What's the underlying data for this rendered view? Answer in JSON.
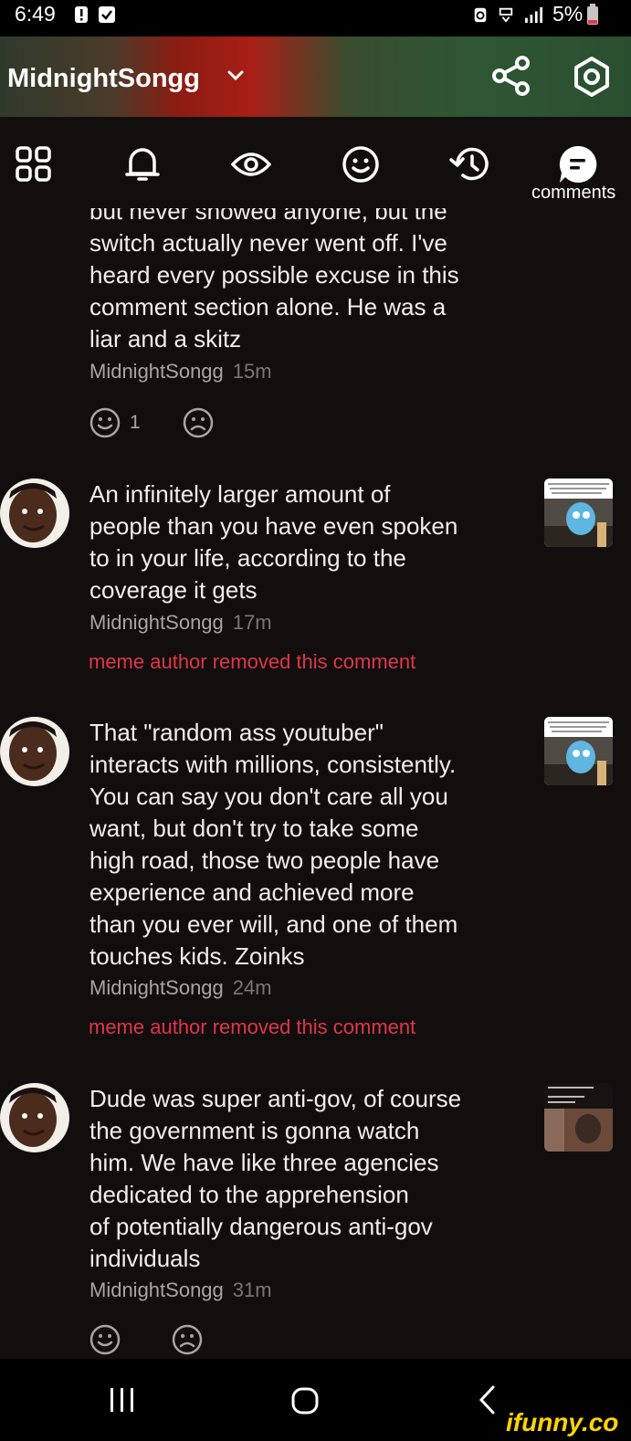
{
  "status_bar": {
    "time": "6:49",
    "battery": "5%",
    "icons": [
      "alert-icon",
      "check-box-icon",
      "recycle-icon",
      "signal-icon",
      "battery-icon"
    ]
  },
  "header": {
    "title": "MidnightSongg",
    "icons": [
      "chevron-down-icon",
      "share-icon",
      "settings-icon"
    ]
  },
  "tabs": {
    "icons": [
      "grid-icon",
      "bell-icon",
      "eye-icon",
      "smile-icon",
      "history-icon",
      "comments-icon"
    ],
    "active_label": "comments"
  },
  "comments": [
    {
      "lines": [
        "but never showed anyone, but the",
        "switch actually never went off. I've",
        "heard every possible excuse in this",
        "comment section alone. He was a",
        "liar and a skitz"
      ],
      "author": "MidnightSongg",
      "time": "15m",
      "smile_count": "1"
    },
    {
      "lines": [
        "An infinitely larger amount of",
        "people than you have even spoken",
        "to in your life, according to the",
        "coverage it gets"
      ],
      "author": "MidnightSongg",
      "time": "17m",
      "removed": "meme author removed this comment"
    },
    {
      "lines": [
        "That \"random ass youtuber\"",
        "interacts with millions, consistently.",
        "You can say you don't care all you",
        "want, but don't try to take some",
        "high road, those two people have",
        "experience and achieved more",
        "than you ever will, and one of them",
        "touches kids. Zoinks"
      ],
      "author": "MidnightSongg",
      "time": "24m",
      "removed": "meme author removed this comment"
    },
    {
      "lines": [
        "Dude was super anti-gov, of course",
        "the government is gonna watch",
        "him. We have like three agencies",
        "dedicated to the apprehension",
        "of potentially dangerous anti-gov",
        "individuals"
      ],
      "author": "MidnightSongg",
      "time": "31m"
    }
  ],
  "nav": {
    "icons": [
      "recents-icon",
      "home-icon",
      "back-icon"
    ]
  },
  "watermark": "ifunny.co",
  "colors": {
    "background": "#120e0d",
    "removed_text": "#e0364b",
    "meta_text": "#a9a5a4",
    "watermark": "#ffd400"
  }
}
